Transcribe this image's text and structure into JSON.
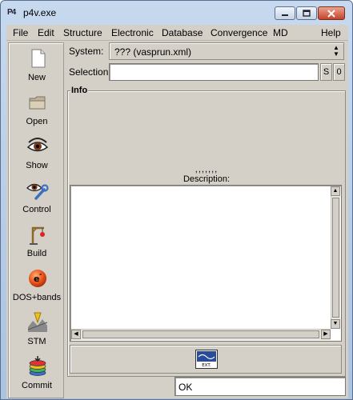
{
  "window": {
    "app_icon_text": "P4",
    "title": "p4v.exe"
  },
  "menu": {
    "items": [
      "File",
      "Edit",
      "Structure",
      "Electronic",
      "Database",
      "Convergence",
      "MD",
      "Help"
    ]
  },
  "sidebar": {
    "items": [
      {
        "label": "New",
        "icon": "document-icon"
      },
      {
        "label": "Open",
        "icon": "folder-icon"
      },
      {
        "label": "Show",
        "icon": "eye-icon"
      },
      {
        "label": "Control",
        "icon": "eye-wrench-icon"
      },
      {
        "label": "Build",
        "icon": "crane-icon"
      },
      {
        "label": "DOS+bands",
        "icon": "electron-icon"
      },
      {
        "label": "STM",
        "icon": "stm-tip-icon"
      },
      {
        "label": "Commit",
        "icon": "database-stack-icon"
      }
    ]
  },
  "system": {
    "label": "System:",
    "value": "??? (vasprun.xml)"
  },
  "selection": {
    "label": "Selection:",
    "value": "",
    "s_button": "S",
    "zero_button": "0"
  },
  "info": {
    "title": "Info",
    "dots": ",,,,,,,",
    "description_label": "Description:",
    "description_value": ""
  },
  "ext_button": {
    "label": "EXT."
  },
  "status": {
    "text": "OK"
  }
}
